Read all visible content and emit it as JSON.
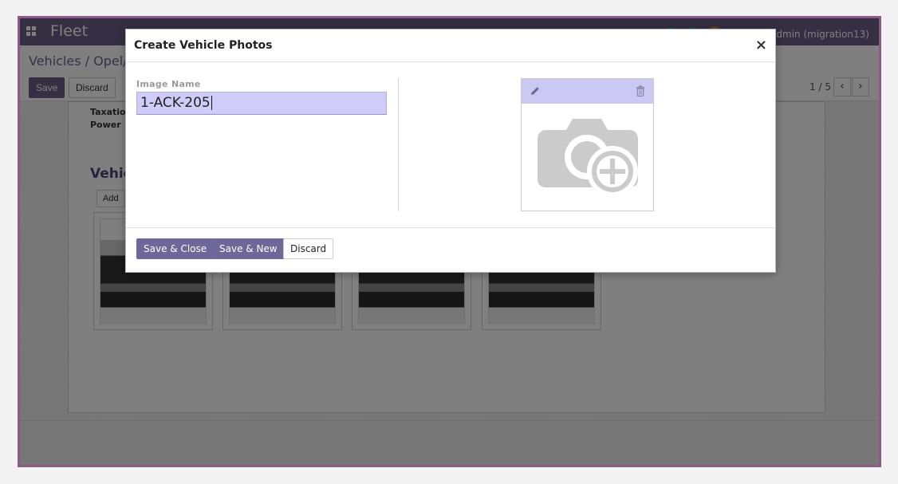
{
  "navbar": {
    "brand": "Fleet",
    "user": "Mitchell Admin (migration13)"
  },
  "control_panel": {
    "breadcrumb": "Vehicles / Opel/",
    "save_label": "Save",
    "discard_label": "Discard",
    "pager": "1 / 5"
  },
  "form": {
    "fields": [
      "Taxatio",
      "Power"
    ],
    "section_title": "Vehic",
    "add_label": "Add"
  },
  "modal": {
    "title": "Create Vehicle Photos",
    "image_name_label": "Image Name",
    "image_name_value": "1-ACK-205",
    "save_close_label": "Save & Close",
    "save_new_label": "Save & New",
    "discard_label": "Discard"
  },
  "icons": {
    "close": "close-icon",
    "edit": "pencil-icon",
    "delete": "trash-icon",
    "camera": "camera-add-icon"
  },
  "colors": {
    "navbar": "#685f86",
    "primary_button": "#6d679a",
    "input_focus": "#cfcdf8",
    "image_toolbar": "#cbc9f3"
  }
}
